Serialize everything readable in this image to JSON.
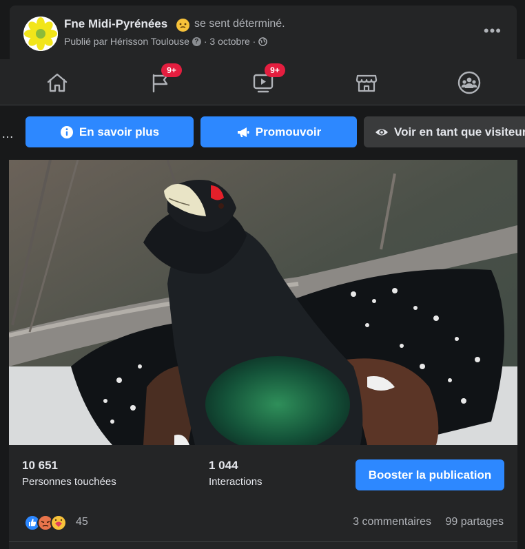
{
  "post": {
    "page_name": "Fne Midi-Pyrénées",
    "feeling": "se sent déterminé.",
    "published_by": "Publié par Hérisson Toulouse",
    "date": "· 3 octobre ·"
  },
  "nav": {
    "pages_badge": "9+",
    "watch_badge": "9+"
  },
  "actions": {
    "overflow": "…",
    "learn_more": "En savoir plus",
    "promote": "Promouvoir",
    "view_as": "Voir en tant que visiteur"
  },
  "stats": {
    "reach_value": "10 651",
    "reach_label": "Personnes touchées",
    "interactions_value": "1 044",
    "interactions_label": "Interactions",
    "boost_label": "Booster la publication"
  },
  "reactions": {
    "count": "45",
    "comments": "3 commentaires",
    "shares": "99 partages"
  },
  "colors": {
    "accent": "#2d88ff",
    "badge": "#e41e3f",
    "surface": "#242526",
    "background": "#18191a"
  }
}
